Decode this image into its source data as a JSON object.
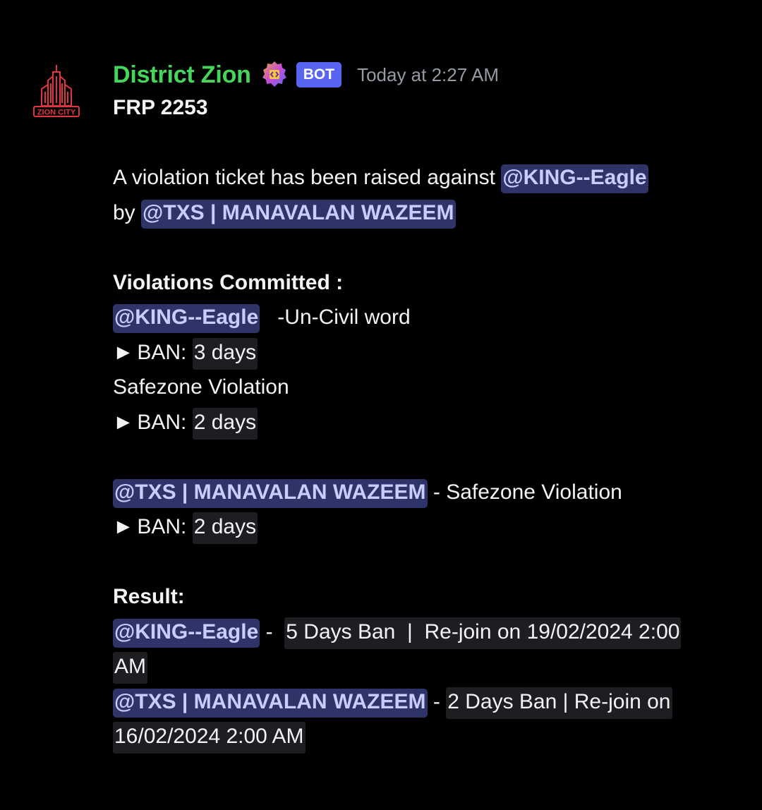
{
  "message": {
    "author": "District Zion",
    "bot_tag": "BOT",
    "timestamp": "Today at 2:27 AM",
    "avatar_text": "ZION CITY",
    "line_title": "FRP 2253",
    "intro_text": "A violation ticket has been raised against ",
    "mention_king": "@KING--Eagle",
    "by_text": "by ",
    "mention_txs": "@TXS | MANAVALAN WAZEEM",
    "violations_heading": "Violations Committed :",
    "v1_desc": "   -Un-Civil word",
    "arrow": "►",
    "ban_label": " BAN: ",
    "ban_3": "3 days",
    "v2_desc": "Safezone Violation",
    "ban_2": "2 days",
    "v3_desc": " - Safezone Violation",
    "result_heading": "Result:",
    "r1_sep": " -  ",
    "r1_text": "5 Days Ban  |  Re-join on 19/02/2024 2:00",
    "r1_cont": "AM",
    "r2_sep": " - ",
    "r2_text": "2 Days Ban | Re-join on",
    "r2_cont": "16/02/2024 2:00 AM"
  },
  "colors": {
    "username": "#45d55a",
    "bot_tag": "#5865f2",
    "mention_bg": "#2e3468",
    "mention_text": "#c9cdfb",
    "code_bg": "#1d1e21",
    "avatar": "#e0343f"
  },
  "icons": {
    "avatar": "zion-city-logo",
    "server_tag": "server-tag-badge-icon"
  }
}
